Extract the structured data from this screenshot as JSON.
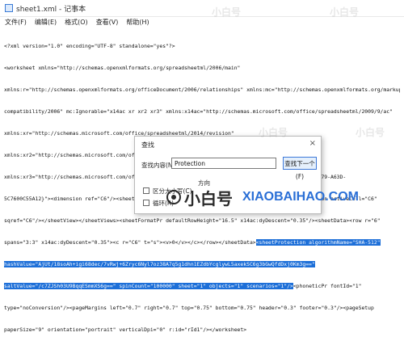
{
  "window": {
    "title": "sheet1.xml - 记事本"
  },
  "menu": [
    "文件(F)",
    "编辑(E)",
    "格式(O)",
    "查看(V)",
    "帮助(H)"
  ],
  "editor": {
    "lines": [
      [
        "<?xml version=\"1.0\" encoding=\"UTF-8\" standalone=\"yes\"?>"
      ],
      [
        "<worksheet xmlns=\"http://schemas.openxmlformats.org/spreadsheetml/2006/main\""
      ],
      [
        "xmlns:r=\"http://schemas.openxmlformats.org/officeDocument/2006/relationships\" xmlns:mc=\"http://schemas.openxmlformats.org/markup-"
      ],
      [
        "compatibility/2006\" mc:Ignorable=\"x14ac xr xr2 xr3\" xmlns:x14ac=\"http://schemas.microsoft.com/office/spreadsheetml/2009/9/ac\""
      ],
      [
        "xmlns:xr=\"http://schemas.microsoft.com/office/spreadsheetml/2014/revision\""
      ],
      [
        "xmlns:xr2=\"http://schemas.microsoft.com/office/spreadsheetml/2015/revision2\""
      ],
      [
        "xmlns:xr3=\"http://schemas.microsoft.com/office/spreadsheetml/2016/revision3\" xr:uid=\"{89E50C1D-83B7-4A79-A63D-"
      ],
      [
        "5C7600C55A12}\"><dimension ref=\"C6\"/><sheetViews><sheetView tabSelected=\"1\" workbookViewId=\"0\"><selection activeCell=\"C6\""
      ],
      [
        "sqref=\"C6\"/></sheetView></sheetViews><sheetFormatPr defaultRowHeight=\"16.5\" x14ac:dyDescent=\"0.35\"/><sheetData><row r=\"6\""
      ],
      [
        "spans=\"3:3\" x14ac:dyDescent=\"0.35\"><c r=\"C6\" t=\"s\"><v>0</v></c></row></sheetData>",
        "<sheetProtection algorithmName=\"SHA-512\""
      ],
      [
        "",
        "hashValue=\"AjUt/18soAh+igi68dec/7vRwj+6Zryc6Nyl7oz38A7q5g1dhn1EZdbYcglywL5axekSC6g3bGwQfdDxj0Km3g==\""
      ],
      [
        "",
        "saltValue=\"/c7ZJSh03U9BqqESmmXS6g==\" spinCount=\"100000\" sheet=\"1\" objects=\"1\" scenarios=\"1\"/>",
        "<phoneticPr fontId=\"1\""
      ],
      [
        "type=\"noConversion\"/><pageMargins left=\"0.7\" right=\"0.7\" top=\"0.75\" bottom=\"0.75\" header=\"0.3\" footer=\"0.3\"/><pageSetup"
      ],
      [
        "paperSize=\"9\" orientation=\"portrait\" verticalDpi=\"0\" r:id=\"rId1\"/></worksheet>"
      ]
    ]
  },
  "find_dialog": {
    "title": "查找",
    "close_glyph": "×",
    "find_label": "查找内容(N):",
    "find_value": "Protection",
    "find_next_label": "查找下一个(F)",
    "direction_label": "方向",
    "match_case_label": "区分大小写(C)",
    "wrap_label": "循环(R)"
  },
  "watermark": {
    "cn": "小白号",
    "url": "XIAOBAIHAO.COM"
  }
}
